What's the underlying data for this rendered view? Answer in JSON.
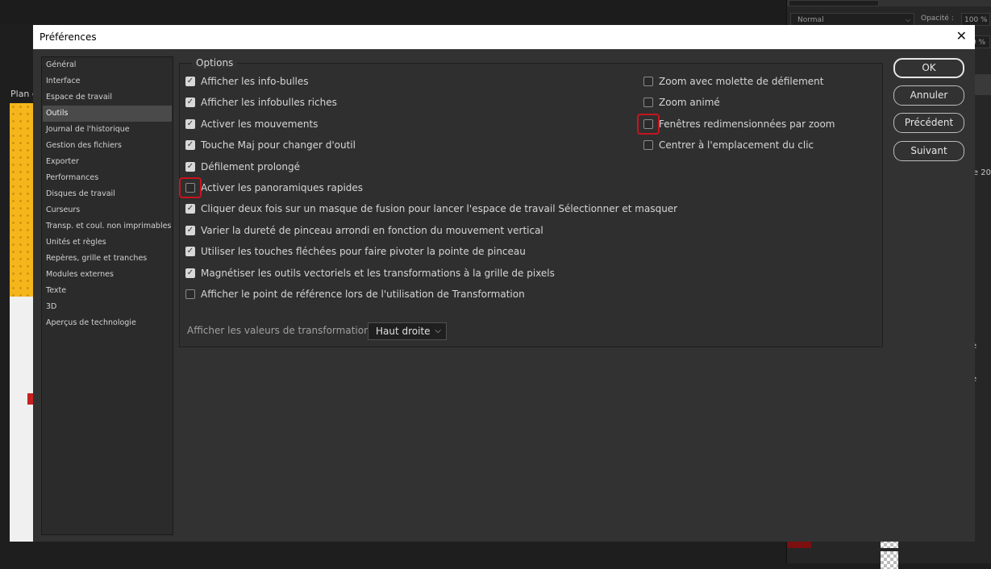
{
  "background_app": {
    "canvas_label": "Plan d",
    "layers_panel": {
      "blend_mode": "Normal",
      "opacity_label": "Opacité :",
      "opacity_value": "100 %",
      "fill_value": "0 %",
      "partial_texts": [
        "re 20",
        "e",
        "e"
      ]
    }
  },
  "dialog": {
    "title": "Préférences",
    "close_glyph": "✕",
    "sidebar": {
      "items": [
        {
          "label": "Général",
          "active": false
        },
        {
          "label": "Interface",
          "active": false
        },
        {
          "label": "Espace de travail",
          "active": false
        },
        {
          "label": "Outils",
          "active": true
        },
        {
          "label": "Journal de l'historique",
          "active": false
        },
        {
          "label": "Gestion des fichiers",
          "active": false
        },
        {
          "label": "Exporter",
          "active": false
        },
        {
          "label": "Performances",
          "active": false
        },
        {
          "label": "Disques de travail",
          "active": false
        },
        {
          "label": "Curseurs",
          "active": false
        },
        {
          "label": "Transp. et coul. non imprimables",
          "active": false
        },
        {
          "label": "Unités et règles",
          "active": false
        },
        {
          "label": "Repères, grille et tranches",
          "active": false
        },
        {
          "label": "Modules externes",
          "active": false
        },
        {
          "label": "Texte",
          "active": false
        },
        {
          "label": "3D",
          "active": false
        },
        {
          "label": "Aperçus de technologie",
          "active": false
        }
      ]
    },
    "options": {
      "group_label": "Options",
      "left_column": [
        {
          "label": "Afficher les info-bulles",
          "checked": true,
          "highlighted": false
        },
        {
          "label": "Afficher les infobulles riches",
          "checked": true,
          "highlighted": false
        },
        {
          "label": "Activer les mouvements",
          "checked": true,
          "highlighted": false
        },
        {
          "label": "Touche Maj pour changer d'outil",
          "checked": true,
          "highlighted": false
        },
        {
          "label": "Défilement prolongé",
          "checked": true,
          "highlighted": false
        },
        {
          "label": "Activer les panoramiques rapides",
          "checked": false,
          "highlighted": true
        },
        {
          "label": "Cliquer deux fois sur un masque de fusion pour lancer l'espace de travail Sélectionner et masquer",
          "checked": true,
          "highlighted": false
        },
        {
          "label": "Varier la dureté de pinceau arrondi en fonction du mouvement vertical",
          "checked": true,
          "highlighted": false
        },
        {
          "label": "Utiliser les touches fléchées pour faire pivoter la pointe de pinceau",
          "checked": true,
          "highlighted": false
        },
        {
          "label": "Magnétiser les outils vectoriels et les transformations à la grille de pixels",
          "checked": true,
          "highlighted": false
        },
        {
          "label": "Afficher le point de référence lors de l'utilisation de Transformation",
          "checked": false,
          "highlighted": false
        }
      ],
      "right_column": [
        {
          "label": "Zoom avec molette de défilement",
          "checked": false,
          "highlighted": false
        },
        {
          "label": "Zoom animé",
          "checked": false,
          "highlighted": false
        },
        {
          "label": "Fenêtres redimensionnées par zoom",
          "checked": false,
          "highlighted": true
        },
        {
          "label": "Centrer à l'emplacement du clic",
          "checked": false,
          "highlighted": false
        }
      ],
      "transform_values": {
        "label": "Afficher les valeurs de transformation :",
        "selected": "Haut droite"
      }
    },
    "buttons": {
      "ok": "OK",
      "cancel": "Annuler",
      "previous": "Précédent",
      "next": "Suivant"
    }
  },
  "colors": {
    "dialog_bg": "#323232",
    "highlight_ring": "#c8141e",
    "selected_nav": "#4a4a4a"
  }
}
